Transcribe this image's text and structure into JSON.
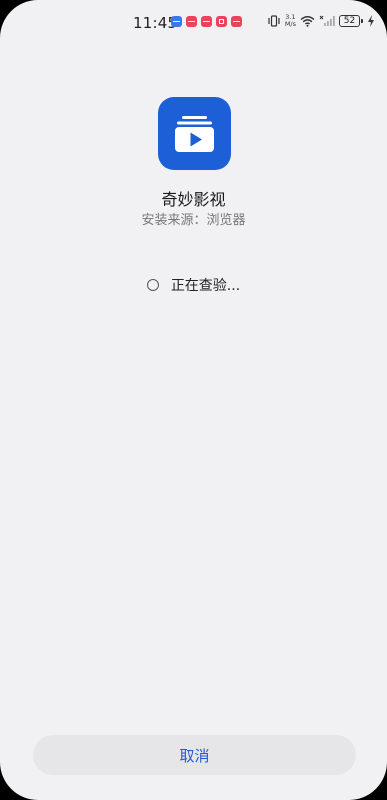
{
  "status_bar": {
    "time": "11:45",
    "net_speed_value": "3.1",
    "net_speed_unit": "M/s",
    "battery_level": "52",
    "notification_icon_colors": [
      "#3b78e7",
      "#e8455a",
      "#e8455a",
      "#e8455a",
      "#e8455a"
    ]
  },
  "app": {
    "name": "奇妙影视",
    "source": "安装来源：浏览器",
    "icon_color": "#1c5fd6"
  },
  "status": {
    "checking_text": "正在查验..."
  },
  "actions": {
    "cancel_label": "取消",
    "accent_color": "#2259d0"
  }
}
